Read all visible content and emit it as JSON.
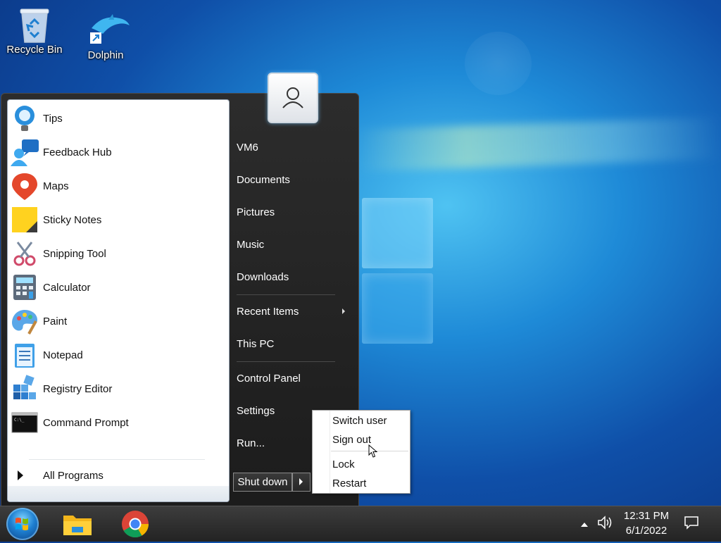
{
  "desktop": {
    "icons": [
      {
        "label": "Recycle Bin",
        "icon": "recycle-bin-icon"
      },
      {
        "label": "Dolphin",
        "icon": "dolphin-icon"
      }
    ]
  },
  "start_menu": {
    "programs": [
      {
        "label": "Tips",
        "icon": "tips-lightbulb-icon"
      },
      {
        "label": "Feedback Hub",
        "icon": "feedback-hub-icon"
      },
      {
        "label": "Maps",
        "icon": "maps-pin-icon"
      },
      {
        "label": "Sticky Notes",
        "icon": "sticky-notes-icon"
      },
      {
        "label": "Snipping Tool",
        "icon": "snipping-tool-icon"
      },
      {
        "label": "Calculator",
        "icon": "calculator-icon"
      },
      {
        "label": "Paint",
        "icon": "paint-palette-icon"
      },
      {
        "label": "Notepad",
        "icon": "notepad-icon"
      },
      {
        "label": "Registry Editor",
        "icon": "registry-editor-icon"
      },
      {
        "label": "Command Prompt",
        "icon": "command-prompt-icon"
      }
    ],
    "all_programs": "All Programs",
    "right_items": [
      {
        "label": "VM6"
      },
      {
        "label": "Documents"
      },
      {
        "label": "Pictures"
      },
      {
        "label": "Music"
      },
      {
        "label": "Downloads"
      },
      {
        "label": "Recent Items"
      },
      {
        "label": "This PC"
      },
      {
        "label": "Control Panel"
      },
      {
        "label": "Settings"
      },
      {
        "label": "Run..."
      }
    ],
    "shutdown_label": "Shut down"
  },
  "power_menu": {
    "items": [
      {
        "label": "Switch user"
      },
      {
        "label": "Sign out"
      },
      {
        "label": "Lock"
      },
      {
        "label": "Restart"
      }
    ]
  },
  "taskbar": {
    "apps": [
      {
        "icon": "file-explorer-icon"
      },
      {
        "icon": "chrome-icon"
      }
    ],
    "time": "12:31 PM",
    "date": "6/1/2022"
  }
}
